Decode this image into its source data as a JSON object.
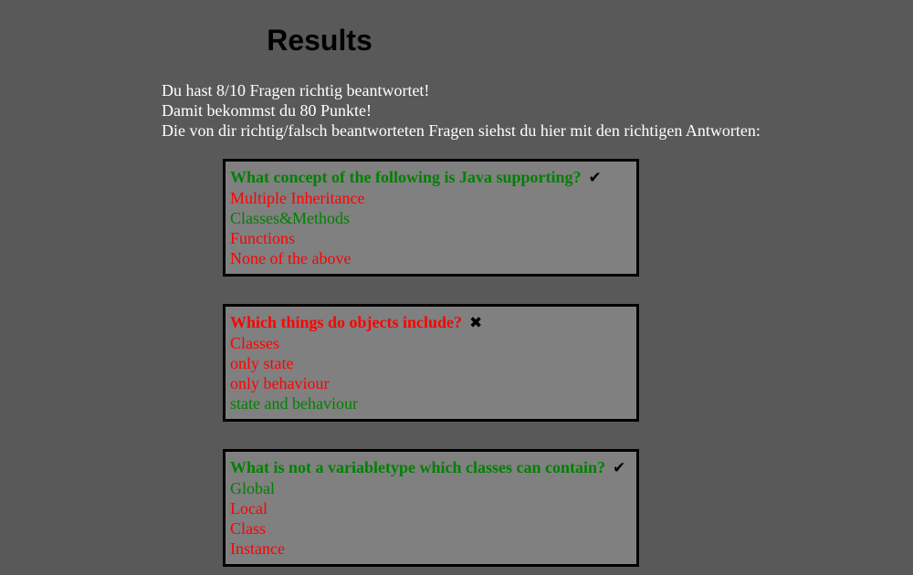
{
  "page": {
    "title": "Results"
  },
  "summary": {
    "line1": "Du hast 8/10 Fragen richtig beantwortet!",
    "line2": "Damit bekommst du 80 Punkte!",
    "line3": "Die von dir richtig/falsch beantworteten Fragen siehst du hier mit den richtigen Antworten:"
  },
  "questions": [
    {
      "text": "What concept of the following is Java supporting?",
      "answered_correctly": true,
      "mark": "✔",
      "answers": [
        {
          "text": "Multiple Inheritance",
          "correct": false
        },
        {
          "text": "Classes&Methods",
          "correct": true
        },
        {
          "text": "Functions",
          "correct": false
        },
        {
          "text": "None of the above",
          "correct": false
        }
      ]
    },
    {
      "text": "Which things do objects include?",
      "answered_correctly": false,
      "mark": "✖",
      "answers": [
        {
          "text": "Classes",
          "correct": false
        },
        {
          "text": "only state",
          "correct": false
        },
        {
          "text": "only behaviour",
          "correct": false
        },
        {
          "text": "state and behaviour",
          "correct": true
        }
      ]
    },
    {
      "text": "What is not a variabletype which classes can contain?",
      "answered_correctly": true,
      "mark": "✔",
      "answers": [
        {
          "text": "Global",
          "correct": true
        },
        {
          "text": "Local",
          "correct": false
        },
        {
          "text": "Class",
          "correct": false
        },
        {
          "text": "Instance",
          "correct": false
        }
      ]
    }
  ],
  "colors": {
    "background": "#595959",
    "box_background": "#808080",
    "correct": "#008000",
    "wrong": "#ff0000"
  },
  "icons": {
    "correct": "check-icon",
    "wrong": "cross-icon"
  }
}
